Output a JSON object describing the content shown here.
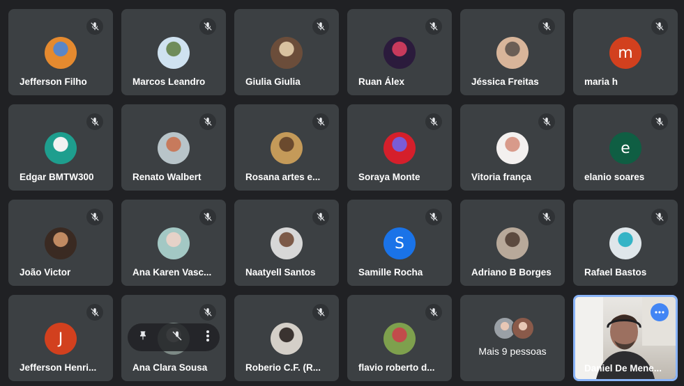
{
  "participants": [
    {
      "name": "Jefferson Filho",
      "avatar": "photo",
      "colors": [
        "#e58a2f",
        "#5b86c7"
      ]
    },
    {
      "name": "Marcos Leandro",
      "avatar": "photo",
      "colors": [
        "#cfe2f0",
        "#6f8c5a"
      ]
    },
    {
      "name": "Giulia Giulia",
      "avatar": "photo",
      "colors": [
        "#6b4d3a",
        "#d9c2a0"
      ]
    },
    {
      "name": "Ruan Álex",
      "avatar": "photo",
      "colors": [
        "#2b1b3c",
        "#c83a5c"
      ]
    },
    {
      "name": "Jéssica Freitas",
      "avatar": "photo",
      "colors": [
        "#d8b59a",
        "#6b5e55"
      ]
    },
    {
      "name": "maria h",
      "avatar": "letter",
      "letter": "m",
      "colors": [
        "#d2401e"
      ]
    },
    {
      "name": "Edgar BMTW300",
      "avatar": "photo",
      "colors": [
        "#1e9e8e",
        "#f2f2f2"
      ]
    },
    {
      "name": "Renato Walbert",
      "avatar": "photo",
      "colors": [
        "#b8c4c9",
        "#c77a5c"
      ]
    },
    {
      "name": "Rosana artes e...",
      "avatar": "photo",
      "colors": [
        "#c49a59",
        "#6b4a2e"
      ]
    },
    {
      "name": "Soraya Monte",
      "avatar": "photo",
      "colors": [
        "#d51f2b",
        "#7a5cd6"
      ]
    },
    {
      "name": "Vitoria frança",
      "avatar": "photo",
      "colors": [
        "#f3f0ef",
        "#d89a8a"
      ]
    },
    {
      "name": "elanio soares",
      "avatar": "letter",
      "letter": "e",
      "colors": [
        "#0f5e43"
      ]
    },
    {
      "name": "João Victor",
      "avatar": "photo",
      "colors": [
        "#3a2a22",
        "#c08a62"
      ]
    },
    {
      "name": "Ana Karen Vasc...",
      "avatar": "photo",
      "colors": [
        "#a3c8c4",
        "#e6d2c8"
      ]
    },
    {
      "name": "Naatyell Santos",
      "avatar": "photo",
      "colors": [
        "#d7d7d7",
        "#7c5a48"
      ]
    },
    {
      "name": "Samille Rocha",
      "avatar": "letter",
      "letter": "S",
      "colors": [
        "#1a73e8"
      ]
    },
    {
      "name": "Adriano B Borges",
      "avatar": "photo",
      "colors": [
        "#b8a99a",
        "#5c4a3f"
      ]
    },
    {
      "name": "Rafael Bastos",
      "avatar": "photo",
      "colors": [
        "#dfe6ea",
        "#35b4c6"
      ]
    },
    {
      "name": "Jefferson Henri...",
      "avatar": "letter",
      "letter": "J",
      "colors": [
        "#d2401e"
      ]
    },
    {
      "name": "Ana Clara Sousa",
      "avatar": "photo",
      "colors": [
        "#7d8a86",
        "#c6cfc8"
      ],
      "hover": true
    },
    {
      "name": "Roberio C.F. (R...",
      "avatar": "photo",
      "colors": [
        "#d4cfc8",
        "#3a3330"
      ]
    },
    {
      "name": "flavio roberto d...",
      "avatar": "photo",
      "colors": [
        "#7ea04d",
        "#c24b4b"
      ]
    }
  ],
  "more": {
    "label": "Mais 9 pessoas",
    "colors": [
      "#9aa0a6",
      "#8a5a4a"
    ]
  },
  "self": {
    "name": "Daniel De Mene..."
  }
}
